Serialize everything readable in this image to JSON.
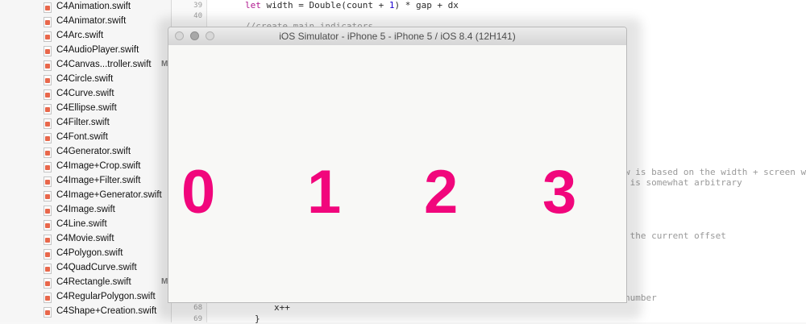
{
  "navigator": {
    "files": [
      {
        "name": "C4Animation.swift",
        "badge": ""
      },
      {
        "name": "C4Animator.swift",
        "badge": ""
      },
      {
        "name": "C4Arc.swift",
        "badge": ""
      },
      {
        "name": "C4AudioPlayer.swift",
        "badge": ""
      },
      {
        "name": "C4Canvas...troller.swift",
        "badge": "M"
      },
      {
        "name": "C4Circle.swift",
        "badge": ""
      },
      {
        "name": "C4Curve.swift",
        "badge": ""
      },
      {
        "name": "C4Ellipse.swift",
        "badge": ""
      },
      {
        "name": "C4Filter.swift",
        "badge": ""
      },
      {
        "name": "C4Font.swift",
        "badge": ""
      },
      {
        "name": "C4Generator.swift",
        "badge": ""
      },
      {
        "name": "C4Image+Crop.swift",
        "badge": ""
      },
      {
        "name": "C4Image+Filter.swift",
        "badge": ""
      },
      {
        "name": "C4Image+Generator.swift",
        "badge": ""
      },
      {
        "name": "C4Image.swift",
        "badge": ""
      },
      {
        "name": "C4Line.swift",
        "badge": ""
      },
      {
        "name": "C4Movie.swift",
        "badge": ""
      },
      {
        "name": "C4Polygon.swift",
        "badge": ""
      },
      {
        "name": "C4QuadCurve.swift",
        "badge": ""
      },
      {
        "name": "C4Rectangle.swift",
        "badge": "M"
      },
      {
        "name": "C4RegularPolygon.swift",
        "badge": ""
      },
      {
        "name": "C4Shape+Creation.swift",
        "badge": ""
      }
    ]
  },
  "editor": {
    "lines": [
      {
        "number": "39",
        "parts": [
          [
            "kw",
            "let"
          ],
          [
            "",
            " width = Double(count + "
          ],
          [
            "num",
            "1"
          ],
          [
            "",
            ") * gap + dx"
          ]
        ]
      },
      {
        "number": "40",
        "parts": []
      },
      {
        "number": "",
        "parts": [
          [
            "cmt",
            "//create main indicators"
          ]
        ]
      },
      {
        "number": "",
        "parts": [
          [
            "cmt",
            "w is based on the width + screen w"
          ]
        ]
      },
      {
        "number": "",
        "parts": [
          [
            "cmt",
            " is somewhat arbitrary"
          ]
        ]
      },
      {
        "number": "",
        "parts": [
          [
            "cmt",
            " the current offset"
          ]
        ]
      },
      {
        "number": "",
        "parts": [
          [
            "cmt",
            "number"
          ]
        ]
      },
      {
        "number": "68",
        "parts": [
          [
            "",
            "x++"
          ]
        ]
      },
      {
        "number": "69",
        "parts": [
          [
            "",
            "}"
          ]
        ]
      }
    ]
  },
  "simulator": {
    "title": "iOS Simulator - iPhone 5 - iPhone 5 / iOS 8.4 (12H141)",
    "digits": [
      "0",
      "1",
      "2",
      "3"
    ],
    "digit_color": "#f1067c"
  }
}
